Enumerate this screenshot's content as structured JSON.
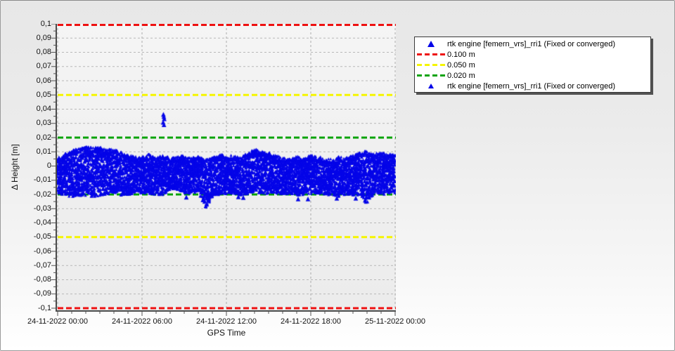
{
  "accent_colors": {
    "data_blue": "#0505e8",
    "limit_red": "#ee1111",
    "limit_yellow": "#f5f500",
    "limit_green": "#0aa30a",
    "grid": "#b8b8b8",
    "axis": "#4b4b4b"
  },
  "chart_data": {
    "type": "scatter",
    "title": "",
    "xlabel": "GPS Time",
    "ylabel": "Δ Height [m]",
    "ylim": [
      -0.1,
      0.1
    ],
    "y_tick_step": 0.01,
    "y_tick_labels": [
      "0,1",
      "0,09",
      "0,08",
      "0,07",
      "0,06",
      "0,05",
      "0,04",
      "0,03",
      "0,02",
      "0,01",
      "0",
      "-0,01",
      "-0,02",
      "-0,03",
      "-0,04",
      "-0,05",
      "-0,06",
      "-0,07",
      "-0,08",
      "-0,09",
      "-0,1"
    ],
    "x_ticks": [
      {
        "hour": 0,
        "label": "24-11-2022 00:00"
      },
      {
        "hour": 6,
        "label": "24-11-2022 06:00"
      },
      {
        "hour": 12,
        "label": "24-11-2022 12:00"
      },
      {
        "hour": 18,
        "label": "24-11-2022 18:00"
      },
      {
        "hour": 24,
        "label": "25-11-2022 00:00"
      }
    ],
    "x_range_hours": [
      0,
      24
    ],
    "grid": true,
    "legend_position": "right-top",
    "thresholds": [
      {
        "label": "0.100 m",
        "value": 0.1,
        "color": "#ee1111"
      },
      {
        "label": "0.050 m",
        "value": 0.05,
        "color": "#f5f500"
      },
      {
        "label": "0.020 m",
        "value": 0.02,
        "color": "#0aa30a"
      }
    ],
    "series": [
      {
        "name": "rtk engine [femern_vrs]_rri1 (Fixed or converged)",
        "marker": "triangle",
        "color": "#0505e8",
        "band": {
          "hours_start": 0,
          "hours_step": 0.5,
          "upper": [
            0.004,
            0.007,
            0.009,
            0.011,
            0.012,
            0.011,
            0.012,
            0.01,
            0.01,
            0.008,
            0.006,
            0.005,
            0.005,
            0.007,
            0.004,
            0.006,
            0.004,
            0.005,
            0.006,
            0.004,
            0.005,
            0.003,
            0.004,
            0.007,
            0.005,
            0.006,
            0.004,
            0.008,
            0.01,
            0.009,
            0.008,
            0.006,
            0.004,
            0.003,
            0.005,
            0.004,
            0.006,
            0.005,
            0.004,
            0.003,
            0.005,
            0.004,
            0.006,
            0.008,
            0.009,
            0.007,
            0.008,
            0.007,
            0.006
          ],
          "lower": [
            -0.0185,
            -0.02,
            -0.021,
            -0.0205,
            -0.02,
            -0.021,
            -0.0205,
            -0.019,
            -0.0185,
            -0.02,
            -0.0195,
            -0.019,
            -0.019,
            -0.0185,
            -0.02,
            -0.0195,
            -0.016,
            -0.0165,
            -0.019,
            -0.0185,
            -0.0175,
            -0.029,
            -0.022,
            -0.0195,
            -0.019,
            -0.0185,
            -0.02,
            -0.0195,
            -0.018,
            -0.0185,
            -0.019,
            -0.0185,
            -0.0195,
            -0.019,
            -0.02,
            -0.0195,
            -0.019,
            -0.0185,
            -0.02,
            -0.0195,
            -0.021,
            -0.0195,
            -0.02,
            -0.02,
            -0.0265,
            -0.0185,
            -0.0195,
            -0.019,
            -0.0185
          ]
        },
        "outliers": [
          [
            7.52,
            0.036
          ],
          [
            7.55,
            0.0345
          ],
          [
            7.58,
            0.033
          ],
          [
            7.5,
            0.0305
          ],
          [
            7.56,
            0.0287
          ],
          [
            9.15,
            -0.0222
          ],
          [
            12.85,
            -0.022
          ],
          [
            13.2,
            -0.0225
          ],
          [
            17.1,
            -0.0235
          ],
          [
            17.8,
            -0.0235
          ],
          [
            19.85,
            -0.023
          ],
          [
            21.2,
            -0.023
          ]
        ]
      }
    ]
  },
  "legend": {
    "entries": [
      {
        "icon": "triangle-large",
        "color": "#0505e8",
        "label": "rtk engine [femern_vrs]_rri1 (Fixed or converged)"
      },
      {
        "icon": "dash",
        "color": "#ee1111",
        "label": "0.100 m"
      },
      {
        "icon": "dash",
        "color": "#f5f500",
        "label": "0.050 m"
      },
      {
        "icon": "dash",
        "color": "#0aa30a",
        "label": "0.020 m"
      },
      {
        "icon": "triangle-small",
        "color": "#0505e8",
        "label": "rtk engine [femern_vrs]_rri1 (Fixed or converged)"
      }
    ]
  }
}
